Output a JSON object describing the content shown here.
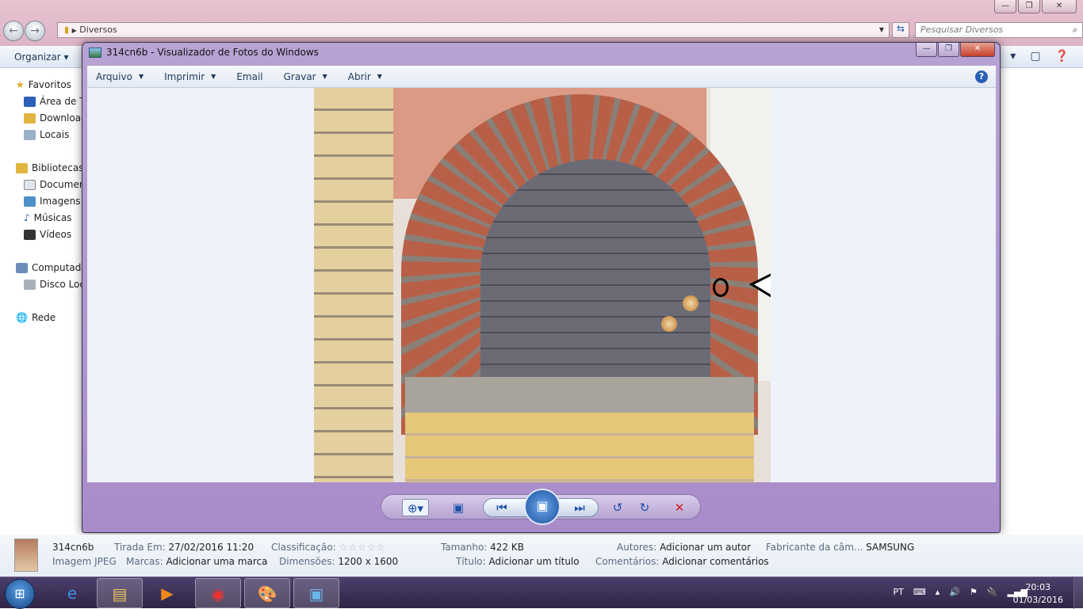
{
  "explorer": {
    "breadcrumb": "Diversos",
    "search_placeholder": "Pesquisar Diversos",
    "toolbar": {
      "organize": "Organizar"
    },
    "nav": [
      {
        "label": "Favoritos",
        "icon": "star-icon"
      },
      {
        "label": "Área de T",
        "icon": "desktop-icon"
      },
      {
        "label": "Download",
        "icon": "downloads-folder-icon"
      },
      {
        "label": "Locais",
        "icon": "recent-places-icon"
      },
      {
        "label": "Bibliotecas",
        "icon": "libraries-icon"
      },
      {
        "label": "Documen",
        "icon": "documents-icon"
      },
      {
        "label": "Imagens",
        "icon": "pictures-icon"
      },
      {
        "label": "Músicas",
        "icon": "music-icon"
      },
      {
        "label": "Vídeos",
        "icon": "videos-icon"
      },
      {
        "label": "Computado",
        "icon": "computer-icon"
      },
      {
        "label": "Disco Loc",
        "icon": "disk-icon"
      },
      {
        "label": "Rede",
        "icon": "network-icon"
      }
    ]
  },
  "viewer": {
    "title": "314cn6b - Visualizador de Fotos do Windows",
    "menu": [
      {
        "label": "Arquivo",
        "dropdown": true
      },
      {
        "label": "Imprimir",
        "dropdown": true
      },
      {
        "label": "Email",
        "dropdown": false
      },
      {
        "label": "Gravar",
        "dropdown": true
      },
      {
        "label": "Abrir",
        "dropdown": true
      }
    ],
    "help": "?"
  },
  "details": {
    "filename": "314cn6b",
    "filetype": "Imagem JPEG",
    "taken_label": "Tirada Em:",
    "taken_value": "27/02/2016 11:20",
    "tags_label": "Marcas:",
    "tags_value": "Adicionar uma marca",
    "rating_label": "Classificação:",
    "rating": 0,
    "rating_stars": "☆☆☆☆☆",
    "dimensions_label": "Dimensões:",
    "dimensions_value": "1200 x 1600",
    "size_label": "Tamanho:",
    "size_value": "422 KB",
    "title_label": "Título:",
    "title_value": "Adicionar um título",
    "authors_label": "Autores:",
    "authors_value": "Adicionar um autor",
    "comments_label": "Comentários:",
    "comments_value": "Adicionar comentários",
    "camera_label": "Fabricante da câm...",
    "camera_value": "SAMSUNG"
  },
  "taskbar": {
    "lang": "PT",
    "time": "20:03",
    "date": "01/03/2016"
  }
}
